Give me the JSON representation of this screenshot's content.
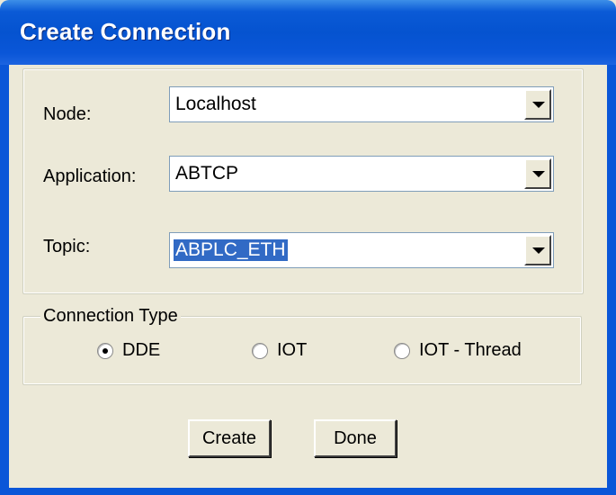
{
  "window": {
    "title": "Create Connection"
  },
  "form": {
    "node": {
      "label": "Node:",
      "value": "Localhost"
    },
    "application": {
      "label": "Application:",
      "value": "ABTCP"
    },
    "topic": {
      "label": "Topic:",
      "value": "ABPLC_ETH"
    }
  },
  "connection_type": {
    "legend": "Connection Type",
    "options": [
      {
        "label": "DDE",
        "checked": true
      },
      {
        "label": "IOT",
        "checked": false
      },
      {
        "label": "IOT - Thread",
        "checked": false
      }
    ]
  },
  "buttons": {
    "create": "Create",
    "done": "Done"
  }
}
